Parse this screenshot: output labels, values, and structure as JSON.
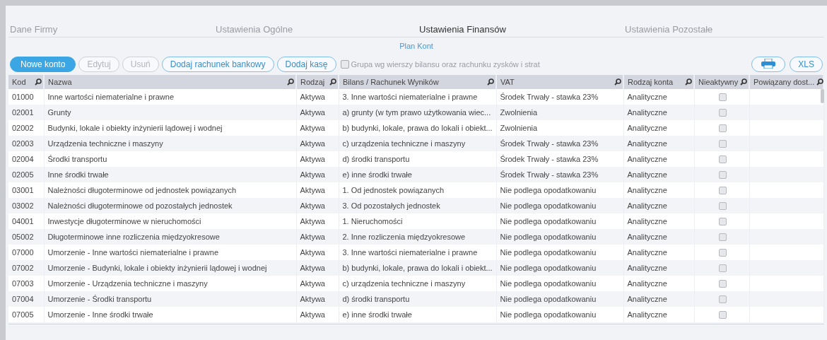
{
  "tabs": [
    {
      "label": "Dane Firmy",
      "selected": false
    },
    {
      "label": "Ustawienia Ogólne",
      "selected": false
    },
    {
      "label": "Ustawienia Finansów",
      "selected": true
    },
    {
      "label": "Ustawienia Pozostałe",
      "selected": false
    }
  ],
  "subtitle": "Plan Kont",
  "toolbar": {
    "buttons": [
      {
        "label": "Nowe konto",
        "kind": "primary",
        "disabled": false
      },
      {
        "label": "Edytuj",
        "kind": "outline",
        "disabled": true
      },
      {
        "label": "Usuń",
        "kind": "outline",
        "disabled": true
      },
      {
        "label": "Dodaj rachunek bankowy",
        "kind": "outline",
        "disabled": false
      },
      {
        "label": "Dodaj kasę",
        "kind": "outline",
        "disabled": false
      }
    ],
    "group_option": {
      "label": "Grupa wg wierszy bilansu oraz rachunku zysków i strat",
      "checked": false
    },
    "export_buttons": [
      {
        "kind": "print"
      },
      {
        "kind": "text",
        "label": "XLS"
      }
    ]
  },
  "table": {
    "columns": [
      "Kod",
      "Nazwa",
      "Rodzaj",
      "Bilans / Rachunek Wyników",
      "VAT",
      "Rodzaj konta",
      "Nieaktywny",
      "Powiązany dost..."
    ],
    "rows": [
      {
        "code": "01000",
        "name": "Inne wartości niematerialne i prawne",
        "type": "Aktywa",
        "balance": "3. Inne wartości niematerialne i prawne",
        "vat": "Środek Trwały - stawka 23%",
        "account_type": "Analityczne",
        "inactive": false
      },
      {
        "code": "02001",
        "name": "Grunty",
        "type": "Aktywa",
        "balance": "a) grunty (w tym prawo użytkowania wiec...",
        "vat": "Zwolnienia",
        "account_type": "Analityczne",
        "inactive": false
      },
      {
        "code": "02002",
        "name": "Budynki, lokale i obiekty inżynierii lądowej i wodnej",
        "type": "Aktywa",
        "balance": "b) budynki, lokale, prawa do lokali i obiekt...",
        "vat": "Zwolnienia",
        "account_type": "Analityczne",
        "inactive": false
      },
      {
        "code": "02003",
        "name": "Urządzenia techniczne i maszyny",
        "type": "Aktywa",
        "balance": "c) urządzenia techniczne i maszyny",
        "vat": "Środek Trwały - stawka 23%",
        "account_type": "Analityczne",
        "inactive": false
      },
      {
        "code": "02004",
        "name": "Środki transportu",
        "type": "Aktywa",
        "balance": "d) środki transportu",
        "vat": "Środek Trwały - stawka 23%",
        "account_type": "Analityczne",
        "inactive": false
      },
      {
        "code": "02005",
        "name": "Inne środki trwałe",
        "type": "Aktywa",
        "balance": "e) inne środki trwałe",
        "vat": "Środek Trwały - stawka 23%",
        "account_type": "Analityczne",
        "inactive": false
      },
      {
        "code": "03001",
        "name": "Należności długoterminowe od jednostek powiązanych",
        "type": "Aktywa",
        "balance": "1. Od jednostek powiązanych",
        "vat": "Nie podlega opodatkowaniu",
        "account_type": "Analityczne",
        "inactive": false
      },
      {
        "code": "03002",
        "name": "Należności długoterminowe od pozostałych jednostek",
        "type": "Aktywa",
        "balance": "3. Od pozostałych jednostek",
        "vat": "Nie podlega opodatkowaniu",
        "account_type": "Analityczne",
        "inactive": false
      },
      {
        "code": "04001",
        "name": "Inwestycje długoterminowe w nieruchomości",
        "type": "Aktywa",
        "balance": "1. Nieruchomości",
        "vat": "Nie podlega opodatkowaniu",
        "account_type": "Analityczne",
        "inactive": false
      },
      {
        "code": "05002",
        "name": "Długoterminowe inne rozliczenia międzyokresowe",
        "type": "Aktywa",
        "balance": "2. Inne rozliczenia międzyokresowe",
        "vat": "Nie podlega opodatkowaniu",
        "account_type": "Analityczne",
        "inactive": false
      },
      {
        "code": "07000",
        "name": "Umorzenie - Inne wartości niematerialne i prawne",
        "type": "Aktywa",
        "balance": "3. Inne wartości niematerialne i prawne",
        "vat": "Nie podlega opodatkowaniu",
        "account_type": "Analityczne",
        "inactive": false
      },
      {
        "code": "07002",
        "name": "Umorzenie - Budynki, lokale i obiekty inżynierii lądowej i wodnej",
        "type": "Aktywa",
        "balance": "b) budynki, lokale, prawa do lokali i obiekt...",
        "vat": "Nie podlega opodatkowaniu",
        "account_type": "Analityczne",
        "inactive": false
      },
      {
        "code": "07003",
        "name": "Umorzenie - Urządzenia techniczne i maszyny",
        "type": "Aktywa",
        "balance": "c) urządzenia techniczne i maszyny",
        "vat": "Nie podlega opodatkowaniu",
        "account_type": "Analityczne",
        "inactive": false
      },
      {
        "code": "07004",
        "name": "Umorzenie - Środki transportu",
        "type": "Aktywa",
        "balance": "d) środki transportu",
        "vat": "Nie podlega opodatkowaniu",
        "account_type": "Analityczne",
        "inactive": false
      },
      {
        "code": "07005",
        "name": "Umorzenie - Inne środki trwałe",
        "type": "Aktywa",
        "balance": "e) inne środki trwałe",
        "vat": "Nie podlega opodatkowaniu",
        "account_type": "Analityczne",
        "inactive": false
      }
    ]
  }
}
